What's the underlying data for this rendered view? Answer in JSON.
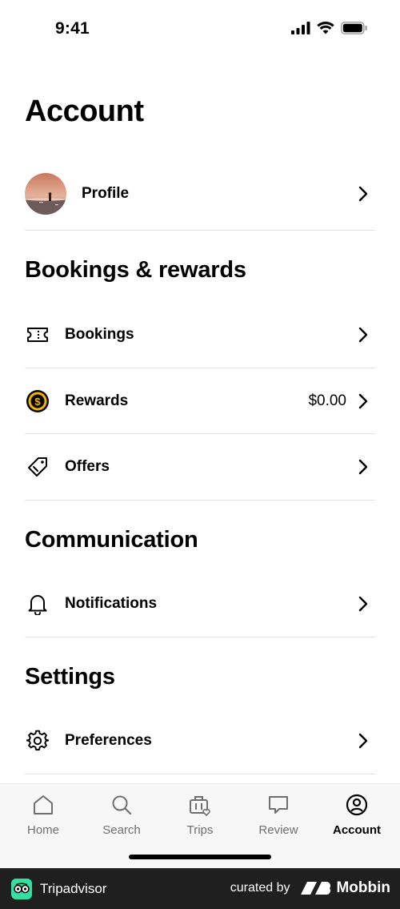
{
  "status_bar": {
    "time": "9:41"
  },
  "page_title": "Account",
  "profile": {
    "label": "Profile"
  },
  "sections": {
    "bookings_rewards": {
      "title": "Bookings & rewards",
      "bookings_label": "Bookings",
      "rewards_label": "Rewards",
      "rewards_value": "$0.00",
      "offers_label": "Offers"
    },
    "communication": {
      "title": "Communication",
      "notifications_label": "Notifications"
    },
    "settings": {
      "title": "Settings",
      "preferences_label": "Preferences"
    }
  },
  "tab_bar": {
    "tabs": [
      {
        "label": "Home",
        "icon": "home-icon"
      },
      {
        "label": "Search",
        "icon": "search-icon"
      },
      {
        "label": "Trips",
        "icon": "trips-icon"
      },
      {
        "label": "Review",
        "icon": "review-icon"
      },
      {
        "label": "Account",
        "icon": "account-icon",
        "active": true
      }
    ]
  },
  "footer": {
    "brand": "Tripadvisor",
    "curated_by": "curated by",
    "curator": "Mobbin"
  },
  "colors": {
    "rewards_coin": "#f5b301",
    "tab_inactive": "#6f6f6f",
    "footer_bg": "#1f1f1f",
    "tripadvisor_green": "#34e0a1"
  }
}
